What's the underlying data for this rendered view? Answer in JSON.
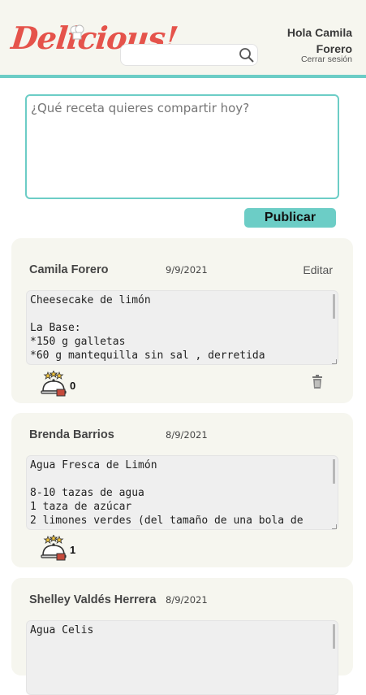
{
  "header": {
    "logo": "Delicious!",
    "greeting": "Hola Camila Forero",
    "logout": "Cerrar sesión",
    "search_value": ""
  },
  "composer": {
    "placeholder": "¿Qué receta quieres compartir hoy?",
    "publish_label": "Publicar"
  },
  "colors": {
    "accent": "#6ccdc6",
    "logo_red": "#e5534b",
    "card_bg": "#f6f6ef"
  },
  "posts": [
    {
      "author": "Camila Forero",
      "date": "9/9/2021",
      "edit_label": "Editar",
      "body": "Cheesecake de limón\n\nLa Base:\n*150 g galletas\n*60 g mantequilla sin sal , derretida",
      "likes": "0",
      "like_icon": "serving-dish-icon",
      "delete_icon": "trash-icon"
    },
    {
      "author": "Brenda Barrios",
      "date": "8/9/2021",
      "body": "Agua Fresca de Limón\n\n8-10 tazas de agua\n1 taza de azúcar\n2 limones verdes (del tamaño de una bola de",
      "likes": "1",
      "like_icon": "serving-dish-icon"
    },
    {
      "author": "Shelley Valdés Herrera",
      "date": "8/9/2021",
      "body": "Agua Celis"
    }
  ]
}
